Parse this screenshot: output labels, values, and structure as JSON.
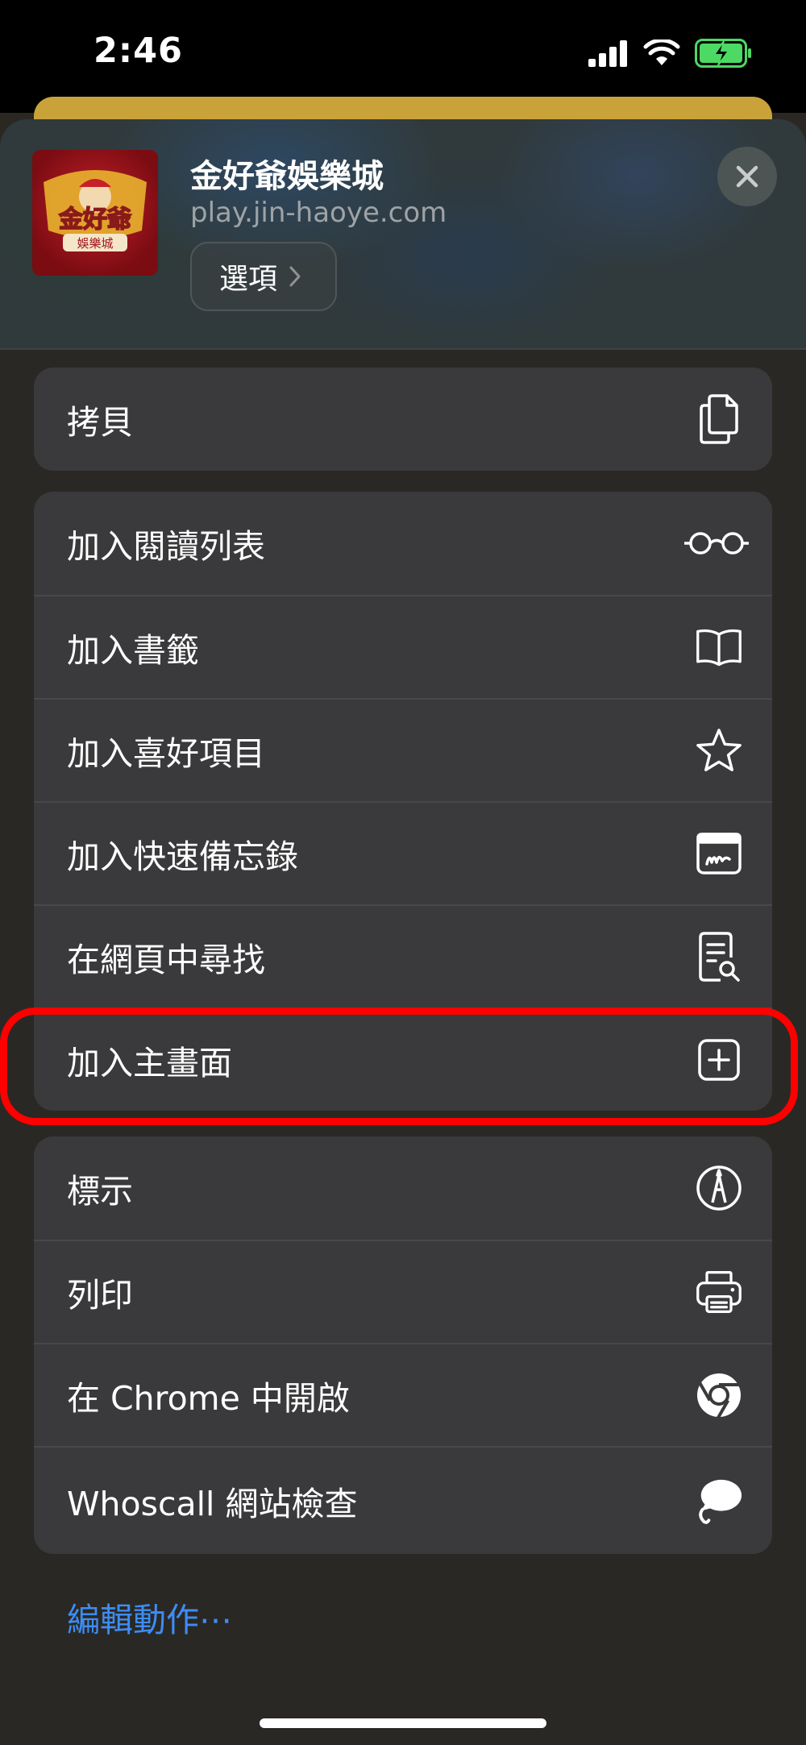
{
  "status_bar": {
    "time": "2:46"
  },
  "share_header": {
    "title": "金好爺娛樂城",
    "url": "play.jin-haoye.com",
    "options_label": "選項",
    "app_icon_text": "金好爺",
    "app_icon_subtext": "娛樂城"
  },
  "groups": [
    {
      "items": [
        {
          "label": "拷貝",
          "icon": "copy-icon"
        }
      ]
    },
    {
      "items": [
        {
          "label": "加入閱讀列表",
          "icon": "glasses-icon"
        },
        {
          "label": "加入書籤",
          "icon": "book-icon"
        },
        {
          "label": "加入喜好項目",
          "icon": "star-icon"
        },
        {
          "label": "加入快速備忘錄",
          "icon": "quick-note-icon"
        },
        {
          "label": "在網頁中尋找",
          "icon": "find-in-page-icon"
        },
        {
          "label": "加入主畫面",
          "icon": "add-square-icon"
        }
      ]
    },
    {
      "items": [
        {
          "label": "標示",
          "icon": "markup-icon"
        },
        {
          "label": "列印",
          "icon": "printer-icon"
        },
        {
          "label": "在 Chrome 中開啟",
          "icon": "chrome-icon"
        },
        {
          "label": "Whoscall 網站檢查",
          "icon": "whoscall-icon"
        }
      ]
    }
  ],
  "edit_actions_label": "編輯動作⋯",
  "colors": {
    "accent": "#3d8df5",
    "highlight": "#ff0000",
    "battery": "#4cd964"
  }
}
